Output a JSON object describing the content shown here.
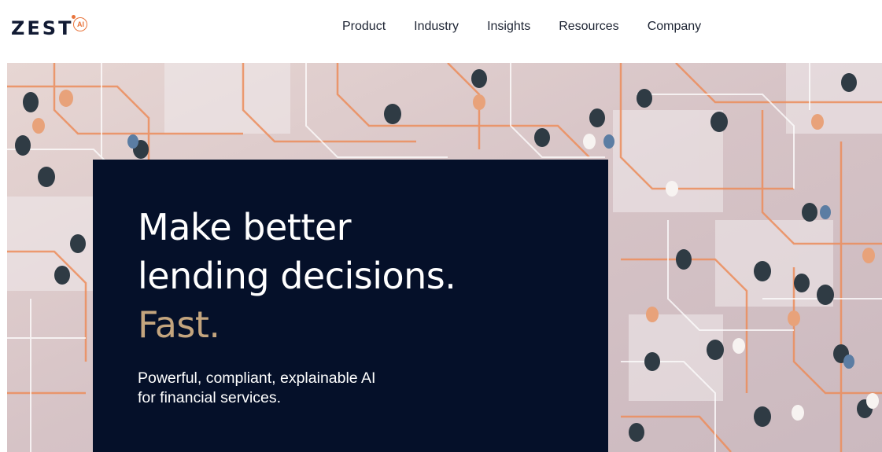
{
  "brand": {
    "name": "ZEST",
    "badge": "AI",
    "accent_color": "#e8743b",
    "text_color": "#111a33"
  },
  "nav": {
    "items": [
      {
        "label": "Product"
      },
      {
        "label": "Industry"
      },
      {
        "label": "Insights"
      },
      {
        "label": "Resources"
      },
      {
        "label": "Company"
      }
    ]
  },
  "hero": {
    "headline_line1": "Make better",
    "headline_line2": "lending decisions.",
    "headline_accent": "Fast.",
    "subheadline_line1": "Powerful, compliant, explainable AI",
    "subheadline_line2": "for financial services.",
    "card_color": "#051029",
    "accent_color": "#c4a57e"
  }
}
